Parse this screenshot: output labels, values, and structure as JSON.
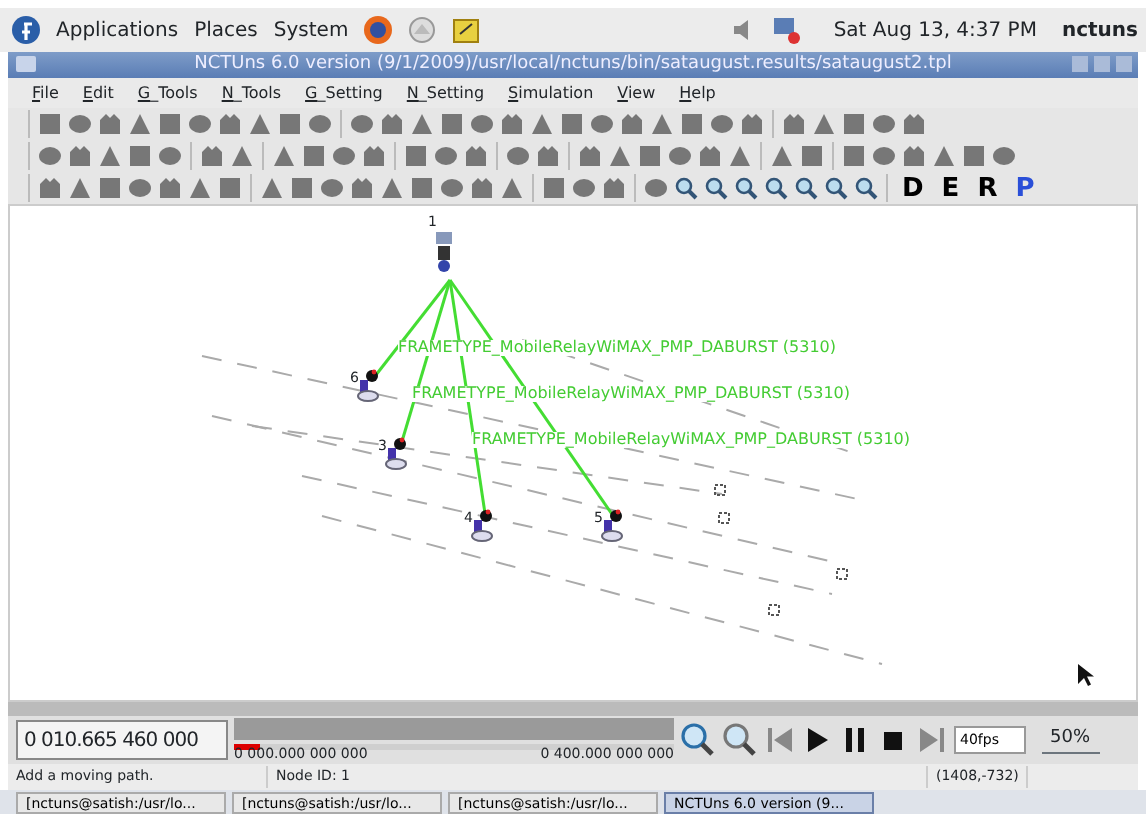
{
  "top_panel": {
    "menus": [
      "Applications",
      "Places",
      "System"
    ],
    "clock": "Sat Aug 13,  4:37 PM",
    "user": "nctuns"
  },
  "window": {
    "title": "NCTUns 6.0 version (9/1/2009)/usr/local/nctuns/bin/sataugust.results/sataugust2.tpl"
  },
  "menu": [
    "File",
    "Edit",
    "G_Tools",
    "N_Tools",
    "G_Setting",
    "N_Setting",
    "Simulation",
    "View",
    "Help"
  ],
  "modes": [
    {
      "label": "D",
      "selected": false
    },
    {
      "label": "E",
      "selected": false
    },
    {
      "label": "R",
      "selected": false
    },
    {
      "label": "P",
      "selected": true
    }
  ],
  "canvas": {
    "nodes": [
      {
        "label": "1",
        "kind": "base"
      },
      {
        "label": "6",
        "kind": "mobile"
      },
      {
        "label": "3",
        "kind": "mobile"
      },
      {
        "label": "4",
        "kind": "mobile"
      },
      {
        "label": "5",
        "kind": "mobile"
      }
    ],
    "links": [
      "FRAMETYPE_MobileRelayWiMAX_PMP_DABURST (5310)",
      "FRAMETYPE_MobileRelayWiMAX_PMP_DABURST (5310)",
      "FRAMETYPE_MobileRelayWiMAX_PMP_DABURST (5310)"
    ]
  },
  "controls": {
    "time": "0 010.665 460 000",
    "start": "0 000.000 000 000",
    "end": "0 400.000 000 000",
    "level": 0.06,
    "fps": "40fps",
    "zoom": "50%"
  },
  "status_bar": [
    "Add a moving path.",
    "Node ID: 1",
    "(1408,-732)"
  ],
  "taskbar": [
    {
      "label": "[nctuns@satish:/usr/lo...",
      "selected": false
    },
    {
      "label": "[nctuns@satish:/usr/lo...",
      "selected": false
    },
    {
      "label": "[nctuns@satish:/usr/lo...",
      "selected": false
    },
    {
      "label": "NCTUns 6.0 version (9...",
      "selected": true
    }
  ]
}
